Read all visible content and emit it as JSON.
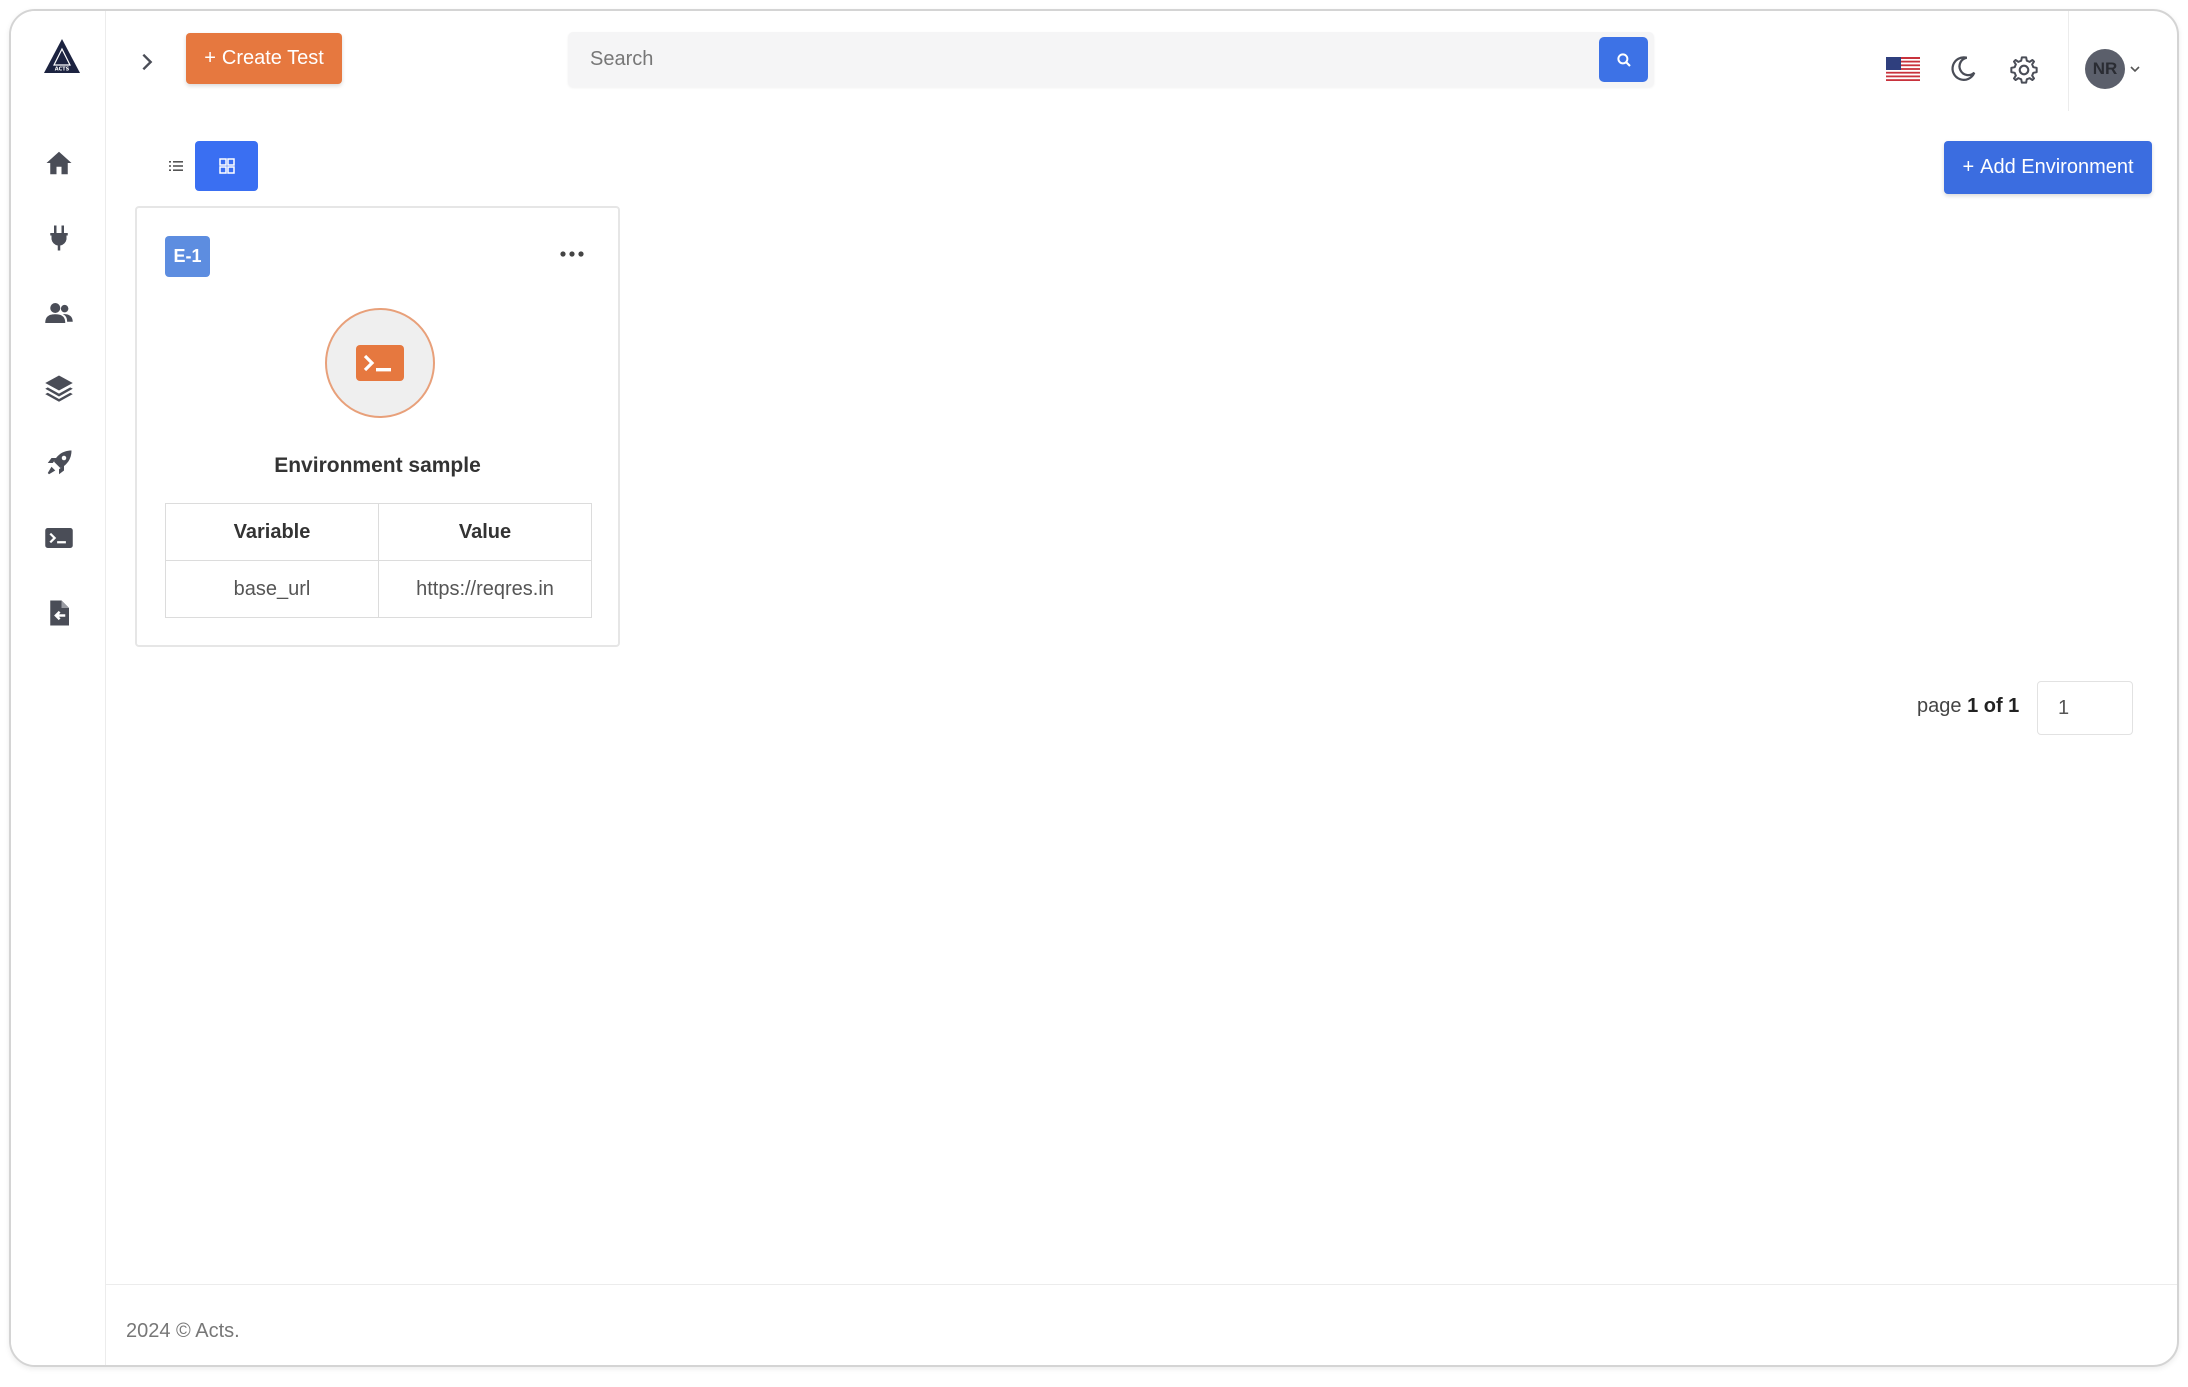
{
  "app": {
    "logo_text": "ACTS",
    "colors": {
      "primary": "#3b6de0",
      "accent": "#e6783f",
      "badge": "#5d8de0"
    }
  },
  "sidebar": {
    "items": [
      {
        "name": "home",
        "icon": "home-icon"
      },
      {
        "name": "plugins",
        "icon": "plug-icon"
      },
      {
        "name": "users",
        "icon": "users-icon"
      },
      {
        "name": "layers",
        "icon": "layers-icon"
      },
      {
        "name": "runs",
        "icon": "rocket-icon"
      },
      {
        "name": "environments",
        "icon": "terminal-icon"
      },
      {
        "name": "reports",
        "icon": "file-import-icon"
      }
    ]
  },
  "header": {
    "create_label": "Create Test",
    "search_placeholder": "Search",
    "user_initials": "NR",
    "language_icon": "us-flag-icon"
  },
  "toolbar": {
    "add_env_label": "Add Environment",
    "active_view": "grid"
  },
  "environments": [
    {
      "badge": "E-1",
      "name": "Environment sample",
      "table_headers": [
        "Variable",
        "Value"
      ],
      "variables": [
        {
          "variable": "base_url",
          "value": "https://reqres.in"
        }
      ]
    }
  ],
  "pagination": {
    "prefix": "page",
    "current_of_total": "1 of 1",
    "input_value": "1"
  },
  "footer": {
    "copyright": "2024 © Acts."
  }
}
